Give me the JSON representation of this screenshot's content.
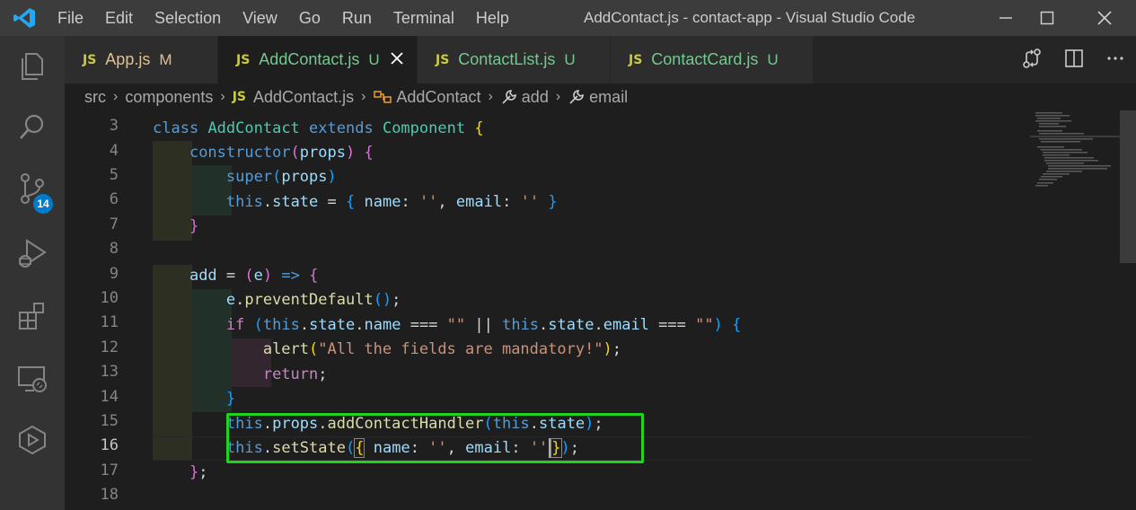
{
  "window": {
    "title": "AddContact.js - contact-app - Visual Studio Code",
    "menu": [
      "File",
      "Edit",
      "Selection",
      "View",
      "Go",
      "Run",
      "Terminal",
      "Help"
    ]
  },
  "activity_bar": {
    "items": [
      "explorer-icon",
      "search-icon",
      "source-control-icon",
      "run-debug-icon",
      "extensions-icon",
      "remote-explorer-icon",
      "docker-icon"
    ],
    "source_control_badge": "14"
  },
  "tabs": [
    {
      "icon": "JS",
      "label": "App.js",
      "status": "M",
      "active": false
    },
    {
      "icon": "JS",
      "label": "AddContact.js",
      "status": "U",
      "active": true
    },
    {
      "icon": "JS",
      "label": "ContactList.js",
      "status": "U",
      "active": false
    },
    {
      "icon": "JS",
      "label": "ContactCard.js",
      "status": "U",
      "active": false
    }
  ],
  "breadcrumbs": {
    "items": [
      "src",
      "components",
      "AddContact.js",
      "AddContact",
      "add",
      "email"
    ],
    "file_icon": "JS"
  },
  "editor": {
    "line_numbers": [
      "3",
      "4",
      "5",
      "6",
      "7",
      "8",
      "9",
      "10",
      "11",
      "12",
      "13",
      "14",
      "15",
      "16",
      "17",
      "18"
    ],
    "current_line": "16"
  },
  "colors": {
    "accent": "#007acc",
    "highlight_box": "#1fd31f",
    "modified": "#e2c08d",
    "untracked": "#73c991"
  }
}
